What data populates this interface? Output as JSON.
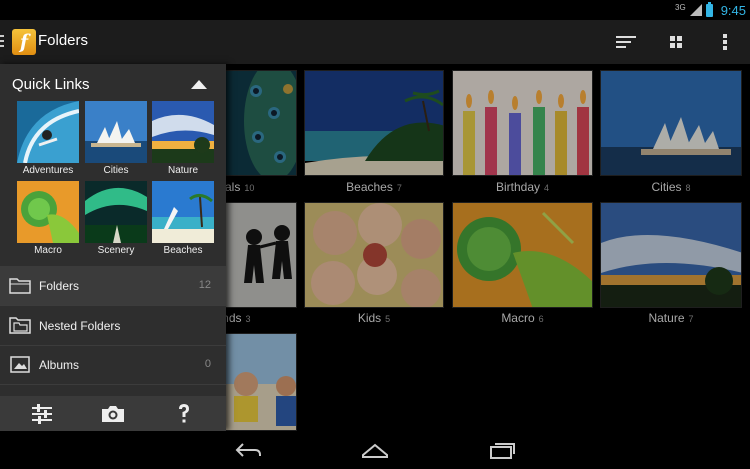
{
  "status_bar": {
    "network": "3G",
    "time": "9:45",
    "accent_color": "#33b5e5"
  },
  "action_bar": {
    "logo_letter": "f",
    "title": "Folders",
    "actions": [
      "sort-icon",
      "grid-view-icon",
      "overflow-menu-icon"
    ]
  },
  "grid": [
    {
      "name": "Animals",
      "count": "10"
    },
    {
      "name": "Beaches",
      "count": "7"
    },
    {
      "name": "Birthday",
      "count": "4"
    },
    {
      "name": "Cities",
      "count": "8"
    },
    {
      "name": "Friends",
      "count": "3"
    },
    {
      "name": "Kids",
      "count": "5"
    },
    {
      "name": "Macro",
      "count": "6"
    },
    {
      "name": "Nature",
      "count": "7"
    },
    {
      "name": "",
      "count": ""
    }
  ],
  "drawer": {
    "quick_links_title": "Quick Links",
    "quick_links": [
      {
        "label": "Adventures"
      },
      {
        "label": "Cities"
      },
      {
        "label": "Nature"
      },
      {
        "label": "Macro"
      },
      {
        "label": "Scenery"
      },
      {
        "label": "Beaches"
      }
    ],
    "nav_items": [
      {
        "label": "Folders",
        "count": "12",
        "icon": "folder-icon"
      },
      {
        "label": "Nested Folders",
        "count": "",
        "icon": "nested-folder-icon"
      },
      {
        "label": "Albums",
        "count": "0",
        "icon": "album-icon"
      }
    ],
    "bottom_actions": [
      "settings-sliders-icon",
      "camera-icon",
      "help-icon"
    ]
  },
  "system_nav": [
    "back-icon",
    "home-icon",
    "recent-apps-icon"
  ]
}
